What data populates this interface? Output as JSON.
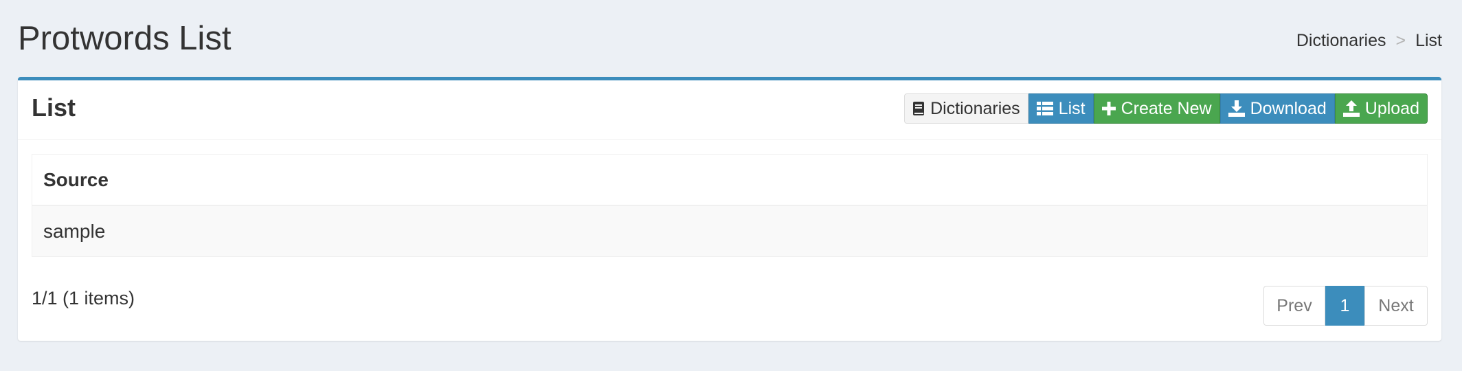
{
  "header": {
    "title": "Protwords List",
    "breadcrumb": {
      "parent": "Dictionaries",
      "separator": ">",
      "current": "List"
    }
  },
  "box": {
    "title": "List",
    "toolbar": {
      "dictionaries": "Dictionaries",
      "list": "List",
      "create_new": "Create New",
      "download": "Download",
      "upload": "Upload"
    }
  },
  "table": {
    "columns": [
      "Source"
    ],
    "rows": [
      [
        "sample"
      ]
    ]
  },
  "pager": {
    "info": "1/1 (1 items)",
    "prev": "Prev",
    "current": "1",
    "next": "Next"
  },
  "colors": {
    "primary": "#3c8dbc",
    "success": "#00a65a",
    "background": "#ecf0f5"
  },
  "icons": {
    "dictionaries": "book-icon",
    "list": "list-icon",
    "create_new": "plus-icon",
    "download": "download-icon",
    "upload": "upload-icon"
  }
}
